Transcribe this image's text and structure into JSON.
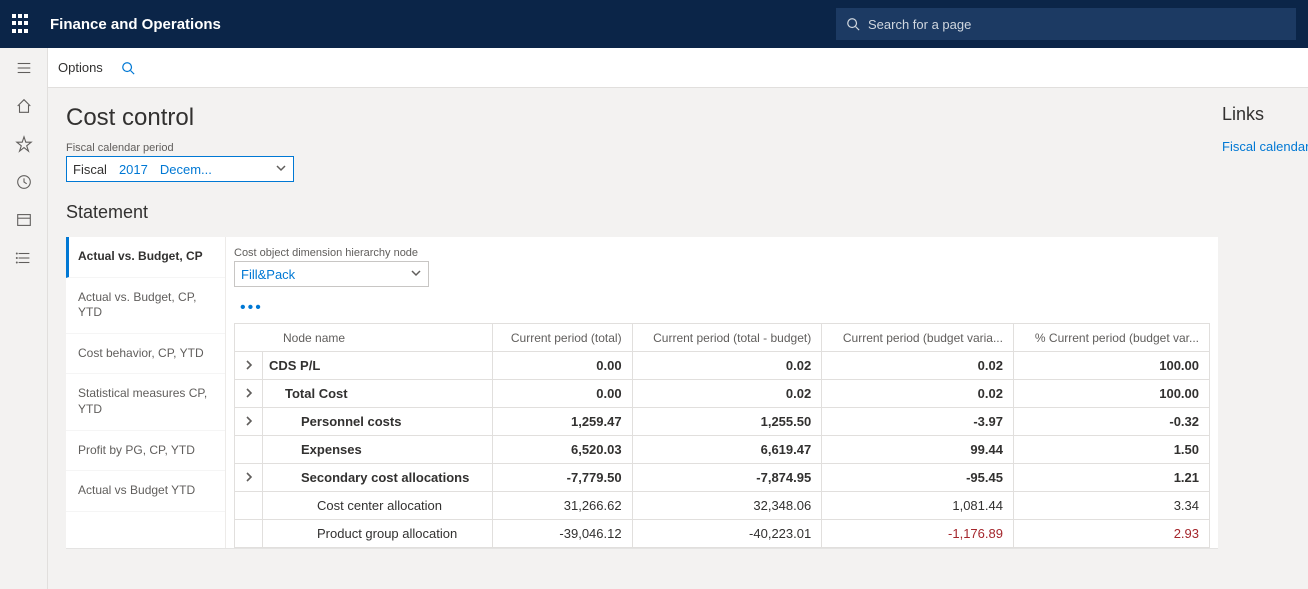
{
  "header": {
    "app_title": "Finance and Operations",
    "search_placeholder": "Search for a page"
  },
  "options_bar": {
    "options_label": "Options"
  },
  "page": {
    "title": "Cost control",
    "period_label": "Fiscal calendar period",
    "period_segments": {
      "fiscal": "Fiscal",
      "year": "2017",
      "month": "Decem..."
    },
    "statement_title": "Statement"
  },
  "links": {
    "title": "Links",
    "items": [
      "Fiscal calendars"
    ]
  },
  "statement": {
    "tabs": [
      "Actual vs. Budget, CP",
      "Actual vs. Budget, CP, YTD",
      "Cost behavior, CP, YTD",
      "Statistical measures CP, YTD",
      "Profit by PG, CP, YTD",
      "Actual vs Budget YTD"
    ],
    "dim_label": "Cost object dimension hierarchy node",
    "dim_value": "Fill&Pack",
    "columns": [
      "Node name",
      "Current period (total)",
      "Current period (total - budget)",
      "Current period (budget varia...",
      "% Current period (budget var..."
    ],
    "rows": [
      {
        "expand": true,
        "indent": 0,
        "bold": true,
        "name": "CDS P/L",
        "c1": "0.00",
        "c2": "0.02",
        "c3": "0.02",
        "c4": "100.00"
      },
      {
        "expand": true,
        "indent": 1,
        "bold": true,
        "name": "Total Cost",
        "c1": "0.00",
        "c2": "0.02",
        "c3": "0.02",
        "c4": "100.00"
      },
      {
        "expand": true,
        "indent": 2,
        "bold": true,
        "name": "Personnel costs",
        "c1": "1,259.47",
        "c2": "1,255.50",
        "c3": "-3.97",
        "c4": "-0.32"
      },
      {
        "expand": false,
        "indent": 2,
        "bold": true,
        "name": "Expenses",
        "c1": "6,520.03",
        "c2": "6,619.47",
        "c3": "99.44",
        "c4": "1.50"
      },
      {
        "expand": true,
        "indent": 2,
        "bold": true,
        "name": "Secondary cost allocations",
        "c1": "-7,779.50",
        "c2": "-7,874.95",
        "c3": "-95.45",
        "c4": "1.21"
      },
      {
        "expand": false,
        "indent": 3,
        "bold": false,
        "name": "Cost center allocation",
        "c1": "31,266.62",
        "c2": "32,348.06",
        "c3": "1,081.44",
        "c4": "3.34"
      },
      {
        "expand": false,
        "indent": 3,
        "bold": false,
        "name": "Product group allocation",
        "c1": "-39,046.12",
        "c2": "-40,223.01",
        "c3": "-1,176.89",
        "c4": "2.93",
        "c3_neg": true,
        "c4_neg": true
      }
    ]
  }
}
